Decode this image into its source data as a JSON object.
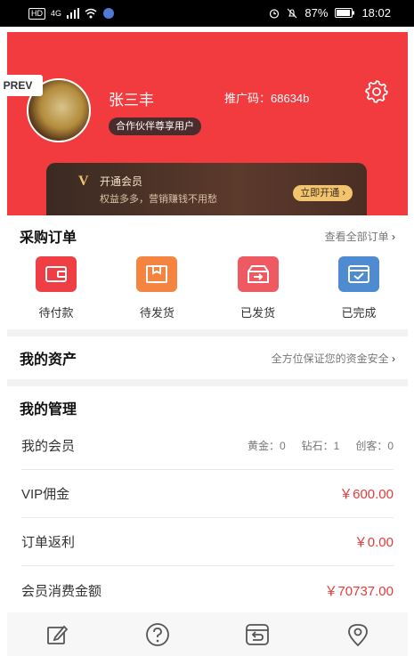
{
  "status_bar": {
    "signal": "4G",
    "hd": "HD",
    "battery": "87%",
    "time": "18:02"
  },
  "profile": {
    "name": "张三丰",
    "promo_code_label": "推广码：68634b",
    "badge": "合作伙伴尊享用户",
    "prev_label": "PREV"
  },
  "vip": {
    "title": "开通会员",
    "subtitle": "权益多多，营销赚钱不用愁",
    "button": "立即开通"
  },
  "orders": {
    "title": "采购订单",
    "more": "查看全部订单",
    "items": [
      {
        "label": "待付款",
        "icon": "wallet-icon",
        "color": "#ef3e44"
      },
      {
        "label": "待发货",
        "icon": "package-icon",
        "color": "#f4843f"
      },
      {
        "label": "已发货",
        "icon": "shipped-box-icon",
        "color": "#ef5a62"
      },
      {
        "label": "已完成",
        "icon": "completed-icon",
        "color": "#4f8bd0"
      }
    ]
  },
  "assets": {
    "title": "我的资产",
    "more": "全方位保证您的资金安全"
  },
  "management": {
    "title": "我的管理",
    "members_label": "我的会员",
    "gold": "黄金：0",
    "diamond": "钻石：1",
    "founder": "创客：0",
    "vip_commission_label": "VIP佣金",
    "vip_commission_value": "￥600.00",
    "rebate_label": "订单返利",
    "rebate_value": "￥0.00",
    "consumption_label": "会员消费金额",
    "consumption_value": "￥70737.00"
  },
  "bottom_nav": [
    "edit-icon",
    "help-icon",
    "return-icon",
    "location-icon"
  ]
}
